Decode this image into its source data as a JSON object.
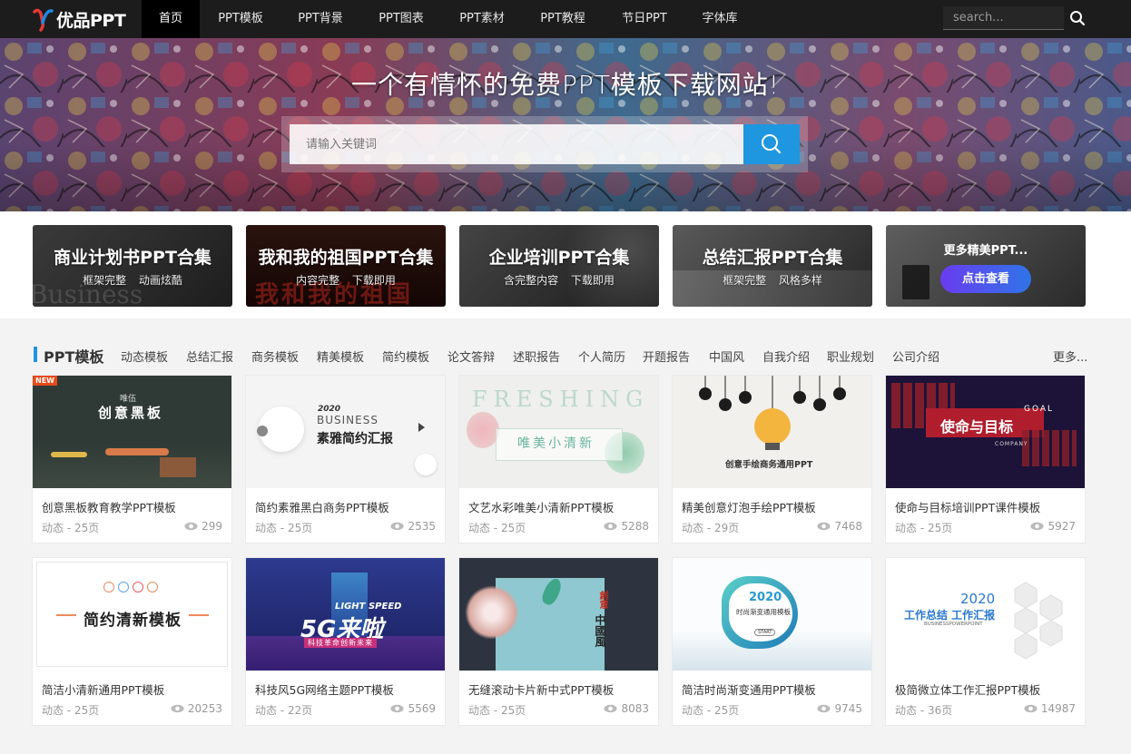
{
  "nav": {
    "logo_text": "优品PPT",
    "items": [
      {
        "label": "首页",
        "active": true
      },
      {
        "label": "PPT模板"
      },
      {
        "label": "PPT背景"
      },
      {
        "label": "PPT图表"
      },
      {
        "label": "PPT素材"
      },
      {
        "label": "PPT教程"
      },
      {
        "label": "节日PPT"
      },
      {
        "label": "字体库"
      }
    ],
    "search_placeholder": "search..."
  },
  "hero": {
    "title": "一个有情怀的免费PPT模板下载网站!",
    "search_placeholder": "请输入关键词"
  },
  "topics": [
    {
      "title": "商业计划书PPT合集",
      "sub": "框架完整 动画炫酷",
      "bg_word": "Business"
    },
    {
      "title": "我和我的祖国PPT合集",
      "sub": "内容完整 下载即用",
      "bg_word": "我和我的祖国"
    },
    {
      "title": "企业培训PPT合集",
      "sub": "含完整内容 下载即用"
    },
    {
      "title": "总结汇报PPT合集",
      "sub": "框架完整 风格多样"
    }
  ],
  "more_topics": {
    "title": "更多精美PPT...",
    "button": "点击查看"
  },
  "section": {
    "title": "PPT模板",
    "links": [
      "动态模板",
      "总结汇报",
      "商务模板",
      "精美模板",
      "简约模板",
      "论文答辩",
      "述职报告",
      "个人简历",
      "开题报告",
      "中国风",
      "自我介绍",
      "职业规划",
      "公司介绍"
    ],
    "more": "更多..."
  },
  "cards": [
    {
      "title": "创意黑板教育教学PPT模板",
      "meta": "动态 - 25页",
      "views": "299",
      "new": "NEW",
      "thumb_texts": [
        "唯伍",
        "创意黑板"
      ]
    },
    {
      "title": "简约素雅黑白商务PPT模板",
      "meta": "动态 - 25页",
      "views": "2535",
      "thumb_texts": [
        "2020",
        "BUSINESS",
        "素雅简约汇报"
      ]
    },
    {
      "title": "文艺水彩唯美小清新PPT模板",
      "meta": "动态 - 25页",
      "views": "5288",
      "thumb_texts": [
        "FRESHING",
        "唯美小清新"
      ]
    },
    {
      "title": "精美创意灯泡手绘PPT模板",
      "meta": "动态 - 29页",
      "views": "7468",
      "thumb_texts": [
        "创意手绘商务通用PPT"
      ]
    },
    {
      "title": "使命与目标培训PPT课件模板",
      "meta": "动态 - 25页",
      "views": "5927",
      "thumb_texts": [
        "GOAL",
        "使命与目标",
        "COMPANY"
      ]
    },
    {
      "title": "简洁小清新通用PPT模板",
      "meta": "动态 - 25页",
      "views": "20253",
      "thumb_texts": [
        "2020",
        "简约清新模板"
      ]
    },
    {
      "title": "科技风5G网络主题PPT模板",
      "meta": "动态 - 22页",
      "views": "5569",
      "thumb_texts": [
        "5G来啦",
        "LIGHT SPEED",
        "科技革命创新未来"
      ]
    },
    {
      "title": "无缝滚动卡片新中式PPT模板",
      "meta": "动态 - 25页",
      "views": "8083",
      "thumb_texts": [
        "創意",
        "中國風"
      ]
    },
    {
      "title": "简洁时尚渐变通用PPT模板",
      "meta": "动态 - 25页",
      "views": "9745",
      "thumb_texts": [
        "2020",
        "时尚渐变通用模板",
        "START"
      ]
    },
    {
      "title": "极简微立体工作汇报PPT模板",
      "meta": "动态 - 36页",
      "views": "14987",
      "thumb_texts": [
        "2020",
        "工作总结 工作汇报",
        "BUSINESSPOWERPOINT"
      ]
    }
  ]
}
